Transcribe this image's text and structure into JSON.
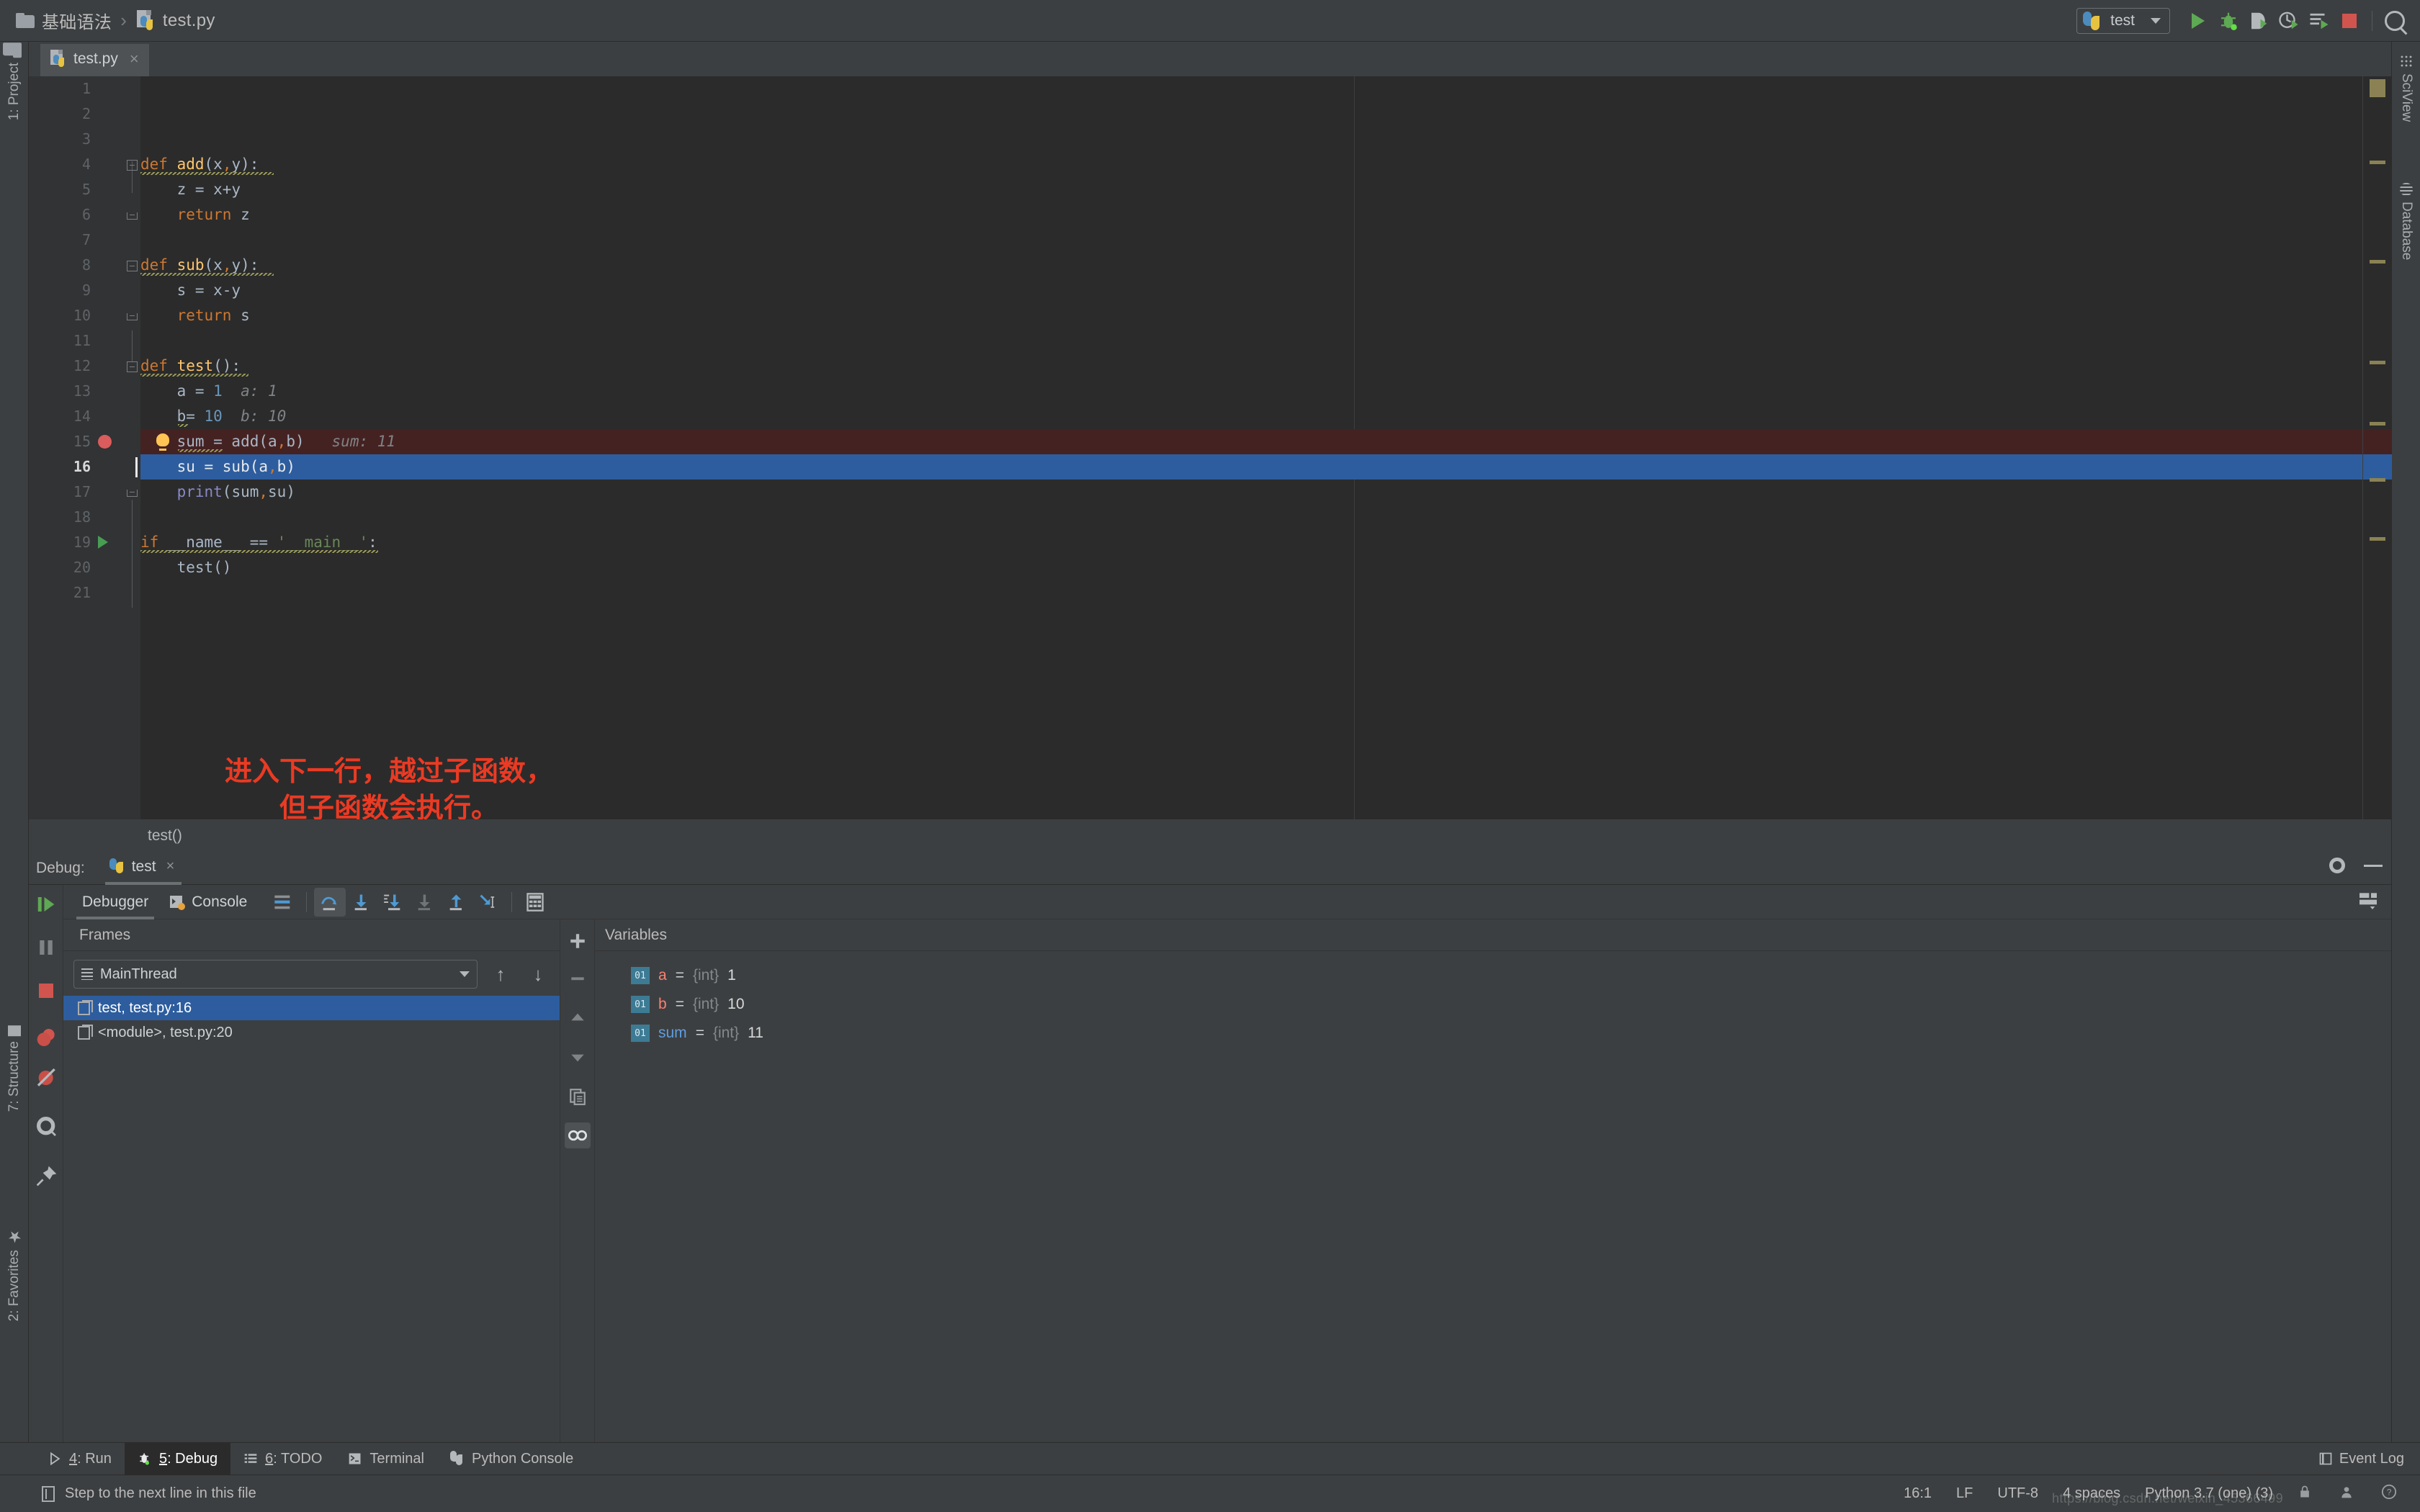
{
  "window": {
    "breadcrumb": {
      "folder": "基础语法",
      "separator": "›",
      "file": "test.py"
    },
    "run_config": {
      "name": "test"
    },
    "toolbar_icons": [
      "run-icon",
      "debug-icon",
      "coverage-icon",
      "profile-icon",
      "run-with-console-icon",
      "stop-icon",
      "search-everywhere-icon"
    ]
  },
  "editor": {
    "tab": {
      "name": "test.py",
      "close": "×"
    },
    "breadcrumb_bottom": "test()",
    "lines": [
      {
        "n": "1",
        "code": ""
      },
      {
        "n": "2",
        "code": ""
      },
      {
        "n": "3",
        "code": ""
      },
      {
        "n": "4",
        "code": "def add(x,y):"
      },
      {
        "n": "5",
        "code": "    z = x+y"
      },
      {
        "n": "6",
        "code": "    return z"
      },
      {
        "n": "7",
        "code": ""
      },
      {
        "n": "8",
        "code": "def sub(x,y):"
      },
      {
        "n": "9",
        "code": "    s = x-y"
      },
      {
        "n": "10",
        "code": "    return s"
      },
      {
        "n": "11",
        "code": ""
      },
      {
        "n": "12",
        "code": "def test():"
      },
      {
        "n": "13",
        "code": "    a = 1",
        "hint": "a: 1"
      },
      {
        "n": "14",
        "code": "    b= 10",
        "hint": "b: 10"
      },
      {
        "n": "15",
        "code": "    sum = add(a,b)",
        "hint": "sum: 11",
        "breakpoint": true
      },
      {
        "n": "16",
        "code": "    su = sub(a,b)",
        "current": true
      },
      {
        "n": "17",
        "code": "    print(sum,su)"
      },
      {
        "n": "18",
        "code": ""
      },
      {
        "n": "19",
        "code": "if __name__ == '__main__':",
        "runmark": true
      },
      {
        "n": "20",
        "code": "    test()"
      },
      {
        "n": "21",
        "code": ""
      }
    ],
    "annotation": {
      "line1": "进入下一行，越过子函数，",
      "line2": "但子函数会执行。",
      "color": "#eb3a23"
    }
  },
  "sidebar_left": [
    {
      "label": "1: Project",
      "icon": "folder-icon"
    },
    {
      "label": "7: Structure",
      "icon": "structure-icon"
    },
    {
      "label": "2: Favorites",
      "icon": "star-icon"
    }
  ],
  "sidebar_right": [
    {
      "label": "SciView",
      "icon": "grid-icon"
    },
    {
      "label": "Database",
      "icon": "database-icon"
    }
  ],
  "debug": {
    "header_label": "Debug:",
    "session_tab": "test",
    "session_close": "×",
    "tabs": [
      {
        "label": "Debugger",
        "active": true,
        "icon": "debugger-icon"
      },
      {
        "label": "Console",
        "active": false,
        "icon": "console-icon"
      }
    ],
    "step_buttons": [
      {
        "name": "show-execution-point-icon",
        "selected": false
      },
      {
        "name": "step-over-icon",
        "selected": true
      },
      {
        "name": "step-into-icon",
        "selected": false
      },
      {
        "name": "force-step-into-icon",
        "selected": false
      },
      {
        "name": "step-into-my-code-icon",
        "selected": false,
        "disabled": true
      },
      {
        "name": "step-out-icon",
        "selected": false
      },
      {
        "name": "run-to-cursor-icon",
        "selected": false
      },
      {
        "name": "evaluate-expression-icon",
        "selected": false
      }
    ],
    "left_buttons": [
      "resume-program-icon",
      "pause-program-icon",
      "stop-icon",
      "view-breakpoints-icon",
      "mute-breakpoints-icon",
      "settings-icon",
      "pin-tab-icon"
    ],
    "frames": {
      "title": "Frames",
      "thread": "MainThread",
      "items": [
        {
          "label": "test, test.py:16",
          "selected": true
        },
        {
          "label": "<module>, test.py:20",
          "selected": false
        }
      ]
    },
    "watch_buttons": [
      "add-watch-icon",
      "remove-watch-icon",
      "move-up-icon",
      "move-down-icon",
      "copy-value-icon",
      "inline-watches-icon"
    ],
    "variables": {
      "title": "Variables",
      "items": [
        {
          "badge": "01",
          "name": "a",
          "eq": "=",
          "type": "{int}",
          "value": "1",
          "color": "red"
        },
        {
          "badge": "01",
          "name": "b",
          "eq": "=",
          "type": "{int}",
          "value": "10",
          "color": "red"
        },
        {
          "badge": "01",
          "name": "sum",
          "eq": "=",
          "type": "{int}",
          "value": "11",
          "color": "blue"
        }
      ]
    }
  },
  "bottom_windows": [
    {
      "num": "4",
      "label": ": Run",
      "active": false,
      "icon": "run-icon"
    },
    {
      "num": "5",
      "label": ": Debug",
      "active": true,
      "icon": "debug-icon"
    },
    {
      "num": "6",
      "label": ": TODO",
      "active": false,
      "icon": "todo-icon"
    },
    {
      "num": "",
      "label": "Terminal",
      "active": false,
      "icon": "terminal-icon"
    },
    {
      "num": "",
      "label": "Python Console",
      "active": false,
      "icon": "python-icon"
    }
  ],
  "event_log": "Event Log",
  "status": {
    "message": "Step to the next line in this file",
    "caret": "16:1",
    "line_sep": "LF",
    "encoding": "UTF-8",
    "indent": "4 spaces",
    "interpreter": "Python 3.7 (one) (3)",
    "watermark": "https://blog.csdn.net/weixin_45366499"
  }
}
